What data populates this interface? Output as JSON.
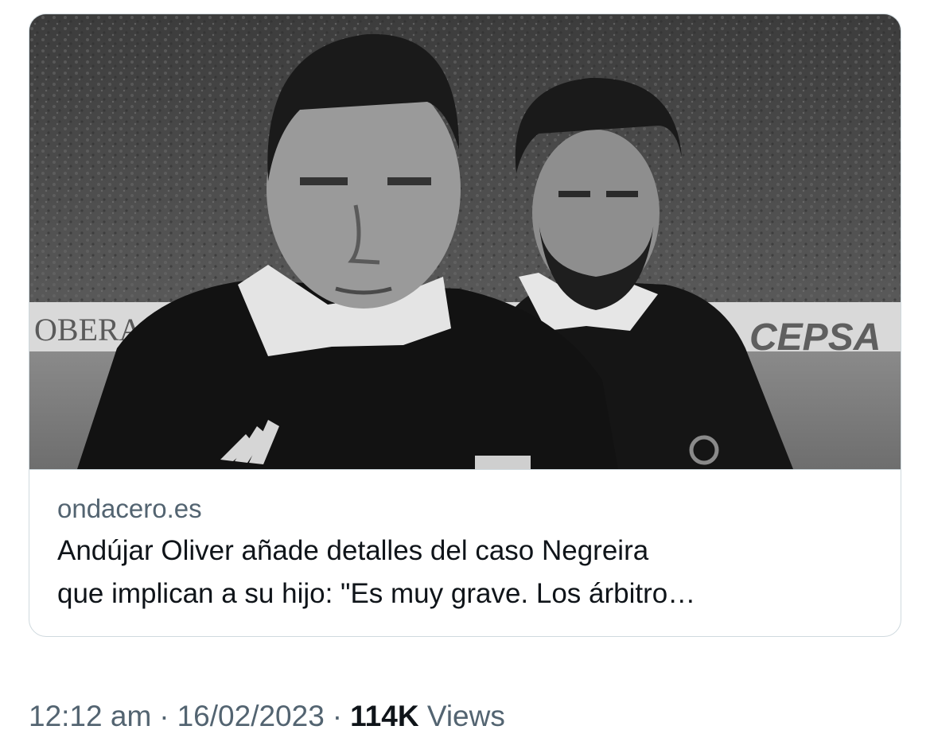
{
  "card": {
    "image": {
      "alt": "",
      "banner_left_text": "OBERA",
      "banner_right_text": "CEPSA"
    },
    "domain": "ondacero.es",
    "title_line_1": "Andújar Oliver añade detalles del caso Negreira",
    "title_line_2": "que implican a su hijo: \"Es muy grave. Los árbitro…"
  },
  "meta": {
    "time": "12:12 am",
    "separator": "·",
    "date": "16/02/2023",
    "views_count": "114K",
    "views_label": "Views"
  },
  "colors": {
    "border": "#cfd9de",
    "secondary_text": "#536471",
    "primary_text": "#0f1419"
  }
}
